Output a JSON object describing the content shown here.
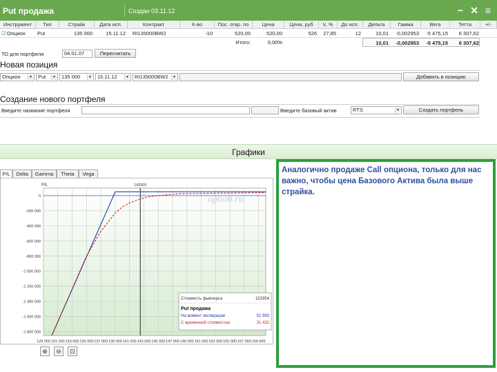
{
  "titlebar": {
    "title": "Put продажа",
    "created": "Создан 03.11.12",
    "btn_min": "−",
    "btn_close": "✕",
    "btn_menu": "≡"
  },
  "table": {
    "headers": [
      "Инструмент",
      "Тип",
      "Страйк",
      "Дата исп.",
      "Контракт",
      "К-во",
      "Пос. откр. по",
      "Цена",
      "Цена, руб",
      "V, %",
      "До исп.",
      "Дельта",
      "Гамма",
      "Вега",
      "Тетта",
      "+/-"
    ],
    "row": {
      "instrument": "Опцион",
      "checked": "☑",
      "type": "Put",
      "strike": "135 000",
      "date": "15.11.12",
      "contract": "RI135000BW2",
      "qty": "-10",
      "pos_open": "520,00",
      "price": "520,00",
      "price_rub": "526",
      "vol": "27,85",
      "days": "12",
      "delta": "10,01",
      "gamma": "-0,002953",
      "vega": "-5 475,15",
      "theta": "6 307,62"
    },
    "totals": {
      "label": "Итого:",
      "pct": "0,00%",
      "delta": "10,01",
      "gamma": "-0,002953",
      "vega": "-5 475,15",
      "theta": "6 307,62"
    }
  },
  "portfolio_date": {
    "label": "ТО для портфеля",
    "value": "04.01.07",
    "button": "Пересчитать"
  },
  "new_position": {
    "title": "Новая позиция",
    "instrument": "Опцион",
    "type": "Put",
    "strike": "135 000",
    "date": "15.11.12",
    "contract": "RI135000BW2",
    "button": "Добавить в позицию"
  },
  "new_portfolio": {
    "title": "Создание нового портфеля",
    "name_label": "Введите название портфеля",
    "asset_label": "Введите базовый актив",
    "asset_value": "RTS",
    "button": "Создать портфель"
  },
  "graphs": {
    "title": "Графики",
    "tabs": [
      "P/L",
      "Delta",
      "Gamma",
      "Theta",
      "Vega"
    ],
    "active_tab": "P/L"
  },
  "chart_data": {
    "type": "line",
    "watermark": "option.ru",
    "ylabel": "P/L",
    "current_price_label": "142500",
    "xlabel_ticks": [
      "129 000",
      "131 000",
      "133 000",
      "135 000",
      "137 000",
      "139 000",
      "141 000",
      "143 000",
      "145 000",
      "147 000",
      "149 000",
      "151 000",
      "153 000",
      "155 000",
      "157 000",
      "159 000"
    ],
    "x_ticks": [
      129000,
      131000,
      133000,
      135000,
      137000,
      139000,
      141000,
      143000,
      145000,
      147000,
      149000,
      151000,
      153000,
      155000,
      157000,
      159000
    ],
    "y_ticks": [
      0,
      -200000,
      -400000,
      -600000,
      -800000,
      -1000000,
      -1200000,
      -1400000,
      -1600000,
      -1800000
    ],
    "y_tick_labels": [
      "0",
      "-200 000",
      "-400 000",
      "-600 000",
      "-800 000",
      "-1 000 000",
      "-1 200 000",
      "-1 400 000",
      "-1 600 000",
      "-1 800 000"
    ],
    "xlim": [
      129000,
      160000
    ],
    "ylim": [
      -1850000,
      100000
    ],
    "grid": true,
    "current_price": 142500,
    "series": [
      {
        "name": "На момент экспирации",
        "color": "#2233aa",
        "x": [
          129000,
          139000,
          160000
        ],
        "y": [
          -2100000,
          50000,
          50000
        ]
      },
      {
        "name": "С временной стоимостью",
        "color": "#cc2222",
        "x": [
          129000,
          135000,
          137000,
          139000,
          140000,
          141000,
          142000,
          143000,
          144000,
          146000,
          148000,
          160000
        ],
        "y": [
          -2100000,
          -800000,
          -470000,
          -230000,
          -150000,
          -95000,
          -60000,
          -30000,
          -10000,
          10000,
          25000,
          40000
        ]
      }
    ],
    "legend": {
      "fut_label": "Стоимость фьючерса",
      "fut_value": "152954",
      "title": "Put продажа",
      "s1_label": "На момент экспирации",
      "s1_value": "52 993",
      "s2_label": "С временной стоимостью",
      "s2_value": "31 432"
    }
  },
  "note": {
    "text": "Аналогично продаже Call опциона, только для нас важно, чтобы цена Базового Актива была выше страйка."
  },
  "zoom": {
    "icons": [
      "zoom-in-icon",
      "zoom-out-icon",
      "zoom-fit-icon"
    ]
  },
  "colors": {
    "accent": "#6aa84f",
    "note_border": "#2e9e3c",
    "note_text": "#2f4f9f"
  }
}
